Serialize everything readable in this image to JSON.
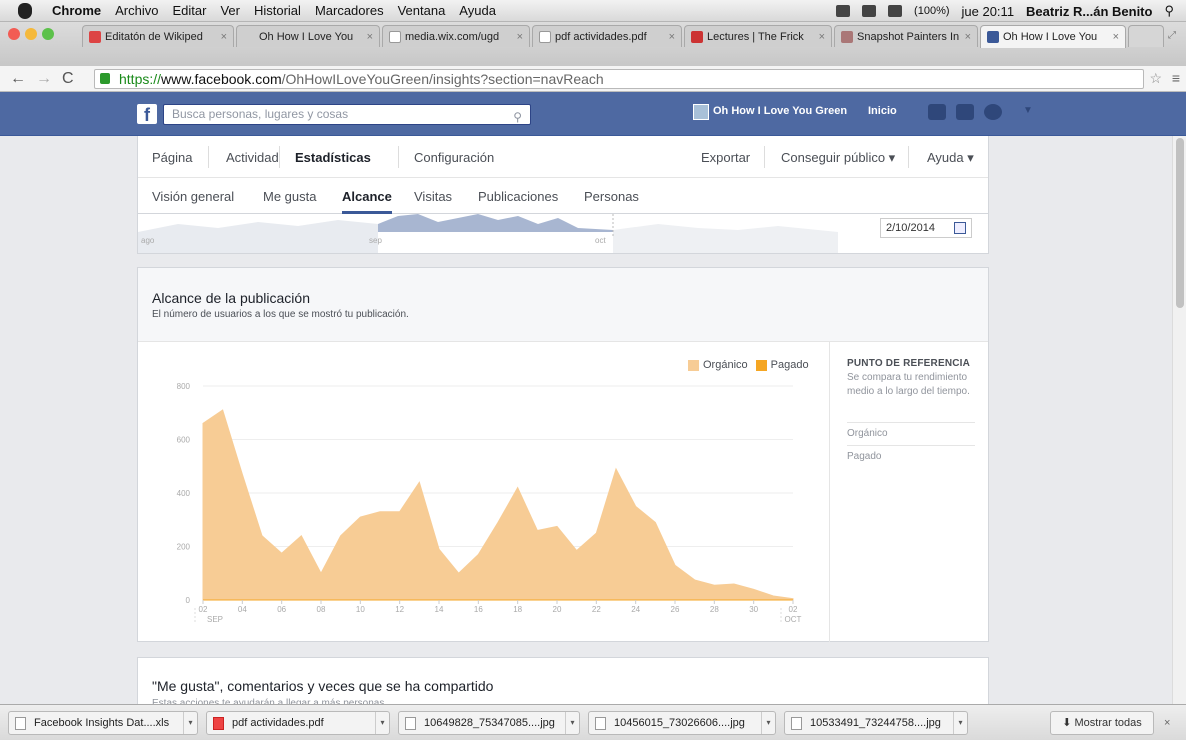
{
  "mac_menu": {
    "app": "Chrome",
    "items": [
      "Archivo",
      "Editar",
      "Ver",
      "Historial",
      "Marcadores",
      "Ventana",
      "Ayuda"
    ],
    "battery": "(100%)",
    "clock": "jue 20:11",
    "user": "Beatriz R...án Benito"
  },
  "tabs": [
    {
      "title": "Editatón de Wikiped",
      "favicon": "gmail-icon",
      "active": false
    },
    {
      "title": "Oh How I Love You",
      "favicon": "blank-icon",
      "active": false
    },
    {
      "title": "media.wix.com/ugd",
      "favicon": "page-icon",
      "active": false
    },
    {
      "title": "pdf actividades.pdf",
      "favicon": "page-icon",
      "active": false
    },
    {
      "title": "Lectures | The Frick",
      "favicon": "frick-icon",
      "active": false
    },
    {
      "title": "Snapshot Painters In",
      "favicon": "snapshot-icon",
      "active": false
    },
    {
      "title": "Oh How I Love You",
      "favicon": "facebook-icon",
      "active": true
    }
  ],
  "address": {
    "scheme": "https://",
    "host": "www.facebook.com",
    "path": "/OhHowILoveYouGreen/insights?section=navReach"
  },
  "fb": {
    "search_placeholder": "Busca personas, lugares y cosas",
    "page_name": "Oh How I Love You Green",
    "home": "Inicio"
  },
  "subnav": {
    "primary": [
      "Página",
      "Actividad",
      "Estadísticas",
      "Configuración"
    ],
    "primary_selected": "Estadísticas",
    "right": [
      "Exportar",
      "Conseguir público ▾",
      "Ayuda ▾"
    ],
    "secondary": [
      "Visión general",
      "Me gusta",
      "Alcance",
      "Visitas",
      "Publicaciones",
      "Personas"
    ],
    "secondary_selected": "Alcance"
  },
  "timeline": {
    "labels": [
      "ago",
      "sep",
      "oct"
    ],
    "date": "2/10/2014"
  },
  "reach_card": {
    "title": "Alcance de la publicación",
    "subtitle": "El número de usuarios a los que se mostró tu publicación."
  },
  "chart_data": {
    "type": "area",
    "x": [
      "02",
      "03",
      "04",
      "05",
      "06",
      "07",
      "08",
      "09",
      "10",
      "11",
      "12",
      "13",
      "14",
      "15",
      "16",
      "17",
      "18",
      "19",
      "20",
      "21",
      "22",
      "23",
      "24",
      "25",
      "26",
      "27",
      "28",
      "29",
      "30",
      "01",
      "02"
    ],
    "xtick_labels": [
      "02",
      "04",
      "06",
      "08",
      "10",
      "12",
      "14",
      "16",
      "18",
      "20",
      "22",
      "24",
      "26",
      "28",
      "30",
      "02"
    ],
    "month_labels": [
      "SEP",
      "OCT"
    ],
    "yticks": [
      "0",
      "200",
      "400",
      "600",
      "800"
    ],
    "ylim": [
      0,
      800
    ],
    "series": [
      {
        "name": "Orgánico",
        "color": "#f7cc95",
        "values": [
          660,
          710,
          470,
          240,
          175,
          240,
          100,
          240,
          310,
          330,
          330,
          440,
          190,
          100,
          170,
          290,
          420,
          260,
          275,
          185,
          250,
          490,
          350,
          290,
          130,
          75,
          55,
          60,
          40,
          15,
          5
        ]
      },
      {
        "name": "Pagado",
        "color": "#f5a623",
        "values": [
          0,
          0,
          0,
          0,
          0,
          0,
          0,
          0,
          0,
          0,
          0,
          0,
          0,
          0,
          0,
          0,
          0,
          0,
          0,
          0,
          0,
          0,
          0,
          0,
          0,
          0,
          0,
          0,
          0,
          0,
          0
        ]
      }
    ],
    "legend": "top-right",
    "grid": true
  },
  "benchmark": {
    "title": "PUNTO DE REFERENCIA",
    "desc": "Se compara tu rendimiento medio a lo largo del tiempo.",
    "items": [
      "Orgánico",
      "Pagado"
    ]
  },
  "likes_card": {
    "title": "\"Me gusta\", comentarios y veces que se ha compartido",
    "subtitle": "Estas acciones te ayudarán a llegar a más personas."
  },
  "downloads": {
    "items": [
      "Facebook Insights Dat....xls",
      "pdf actividades.pdf",
      "10649828_75347085....jpg",
      "10456015_73026606....jpg",
      "10533491_73244758....jpg"
    ],
    "show_all": "Mostrar todas"
  },
  "colors": {
    "fb_blue": "#4e69a2",
    "organic": "#f7cc95",
    "paid": "#f5a623"
  }
}
